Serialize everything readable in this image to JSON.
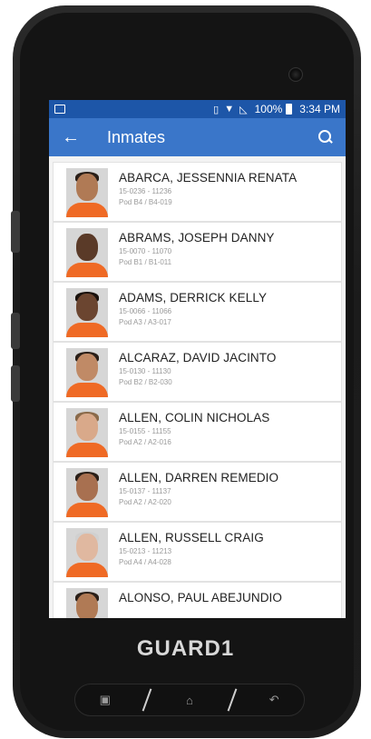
{
  "status_bar": {
    "battery": "100%",
    "time": "3:34 PM"
  },
  "app_bar": {
    "title": "Inmates"
  },
  "inmates": [
    {
      "name": "ABARCA, JESSENNIA RENATA",
      "ids": "15-0236 - 11236",
      "pod": "Pod B4 / B4-019"
    },
    {
      "name": "ABRAMS, JOSEPH DANNY",
      "ids": "15-0070 - 11070",
      "pod": "Pod B1 / B1-011"
    },
    {
      "name": "ADAMS, DERRICK KELLY",
      "ids": "15-0066 - 11066",
      "pod": "Pod A3 / A3-017"
    },
    {
      "name": "ALCARAZ, DAVID JACINTO",
      "ids": "15-0130 - 11130",
      "pod": "Pod B2 / B2-030"
    },
    {
      "name": "ALLEN, COLIN NICHOLAS",
      "ids": "15-0155 - 11155",
      "pod": "Pod A2 / A2-016"
    },
    {
      "name": "ALLEN, DARREN REMEDIO",
      "ids": "15-0137 - 11137",
      "pod": "Pod A2 / A2-020"
    },
    {
      "name": "ALLEN, RUSSELL CRAIG",
      "ids": "15-0213 - 11213",
      "pod": "Pod A4 / A4-028"
    },
    {
      "name": "ALONSO, PAUL ABEJUNDIO",
      "ids": "",
      "pod": ""
    }
  ],
  "device": {
    "brand": "GUARD1"
  },
  "colors": {
    "status_bar": "#1d56a8",
    "app_bar": "#3a76c9",
    "shirt": "#ef6a25"
  }
}
